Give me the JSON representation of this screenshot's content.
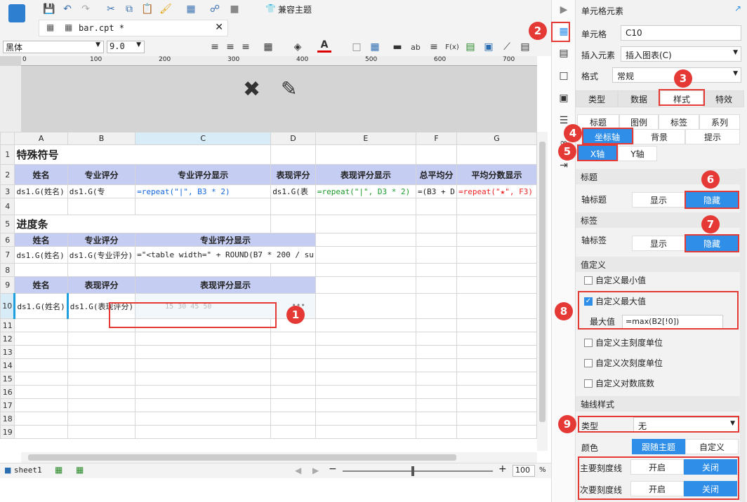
{
  "toolbar": {
    "compat_theme": "兼容主题",
    "font_name": "黑体",
    "font_size": "9.0"
  },
  "file_tab": {
    "name": "bar.cpt *"
  },
  "columns": [
    "A",
    "B",
    "C",
    "D",
    "E",
    "F",
    "G"
  ],
  "rows": [
    "1",
    "2",
    "3",
    "4",
    "5",
    "6",
    "7",
    "8",
    "9",
    "10",
    "11",
    "12",
    "13",
    "14",
    "15",
    "16",
    "17",
    "18",
    "19"
  ],
  "ruler_ticks": [
    "0",
    "100",
    "200",
    "300",
    "400",
    "500",
    "600",
    "700"
  ],
  "cells": {
    "r1a": "特殊符号",
    "r2a": "姓名",
    "r2b": "专业评分",
    "r2c": "专业评分显示",
    "r2d": "表现评分",
    "r2e": "表现评分显示",
    "r2f": "总平均分",
    "r2g": "平均分数显示",
    "r3a": "ds1.G(姓名)",
    "r3b": "ds1.G(专",
    "r3c": "=repeat(\"|\", B3 * 2)",
    "r3d": "ds1.G(表",
    "r3e": "=repeat(\"|\", D3 * 2)",
    "r3f": "=(B3 + D",
    "r3g": "=repeat(\"★\", F3)",
    "r5a": "进度条",
    "r6a": "姓名",
    "r6b": "专业评分",
    "r6c": "专业评分显示",
    "r7a": "ds1.G(姓名)",
    "r7b": "ds1.G(专业评分)",
    "r7c": "=\"<table width=\" + ROUND(B7 * 200 / su",
    "r9a": "姓名",
    "r9b": "表现评分",
    "r9c": "表现评分显示",
    "r10a": "ds1.G(姓名)",
    "r10b": "ds1.G(表现评分)",
    "r10c": "15 30 45 50",
    "r10dots": "•••"
  },
  "sheet_tab": "sheet1",
  "zoom": "100",
  "zoom_unit": "%",
  "panel": {
    "title": "单元格元素",
    "cell_label": "单元格",
    "cell_value": "C10",
    "insert_label": "插入元素",
    "insert_value": "插入图表(C)",
    "format_label": "格式",
    "format_value": "常规",
    "tabs": [
      "类型",
      "数据",
      "样式",
      "特效"
    ],
    "subtabs1": [
      "标题",
      "图例",
      "标签",
      "系列"
    ],
    "subtabs2": [
      "坐标轴",
      "背景",
      "提示"
    ],
    "axis_tabs": [
      "X轴",
      "Y轴"
    ],
    "title_group": "标题",
    "axis_title_label": "轴标题",
    "show": "显示",
    "hide": "隐藏",
    "label_group": "标签",
    "axis_label_label": "轴标签",
    "value_group": "值定义",
    "custom_min": "自定义最小值",
    "custom_max": "自定义最大值",
    "max_label": "最大值",
    "max_value": "=max(B2[!0])",
    "custom_major": "自定义主刻度单位",
    "custom_minor": "自定义次刻度单位",
    "custom_log": "自定义对数底数",
    "axis_style_group": "轴线样式",
    "type_label": "类型",
    "type_value": "无",
    "color_label": "颜色",
    "follow_theme": "跟随主题",
    "custom": "自定义",
    "major_tick": "主要刻度线",
    "minor_tick": "次要刻度线",
    "on": "开启",
    "off": "关闭"
  },
  "badges": [
    "1",
    "2",
    "3",
    "4",
    "5",
    "6",
    "7",
    "8",
    "9"
  ],
  "accent": "#2f8fe8",
  "highlight": "#e53935"
}
